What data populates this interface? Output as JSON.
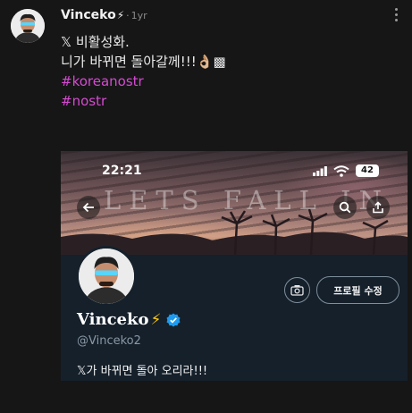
{
  "post": {
    "author": "Vinceko",
    "author_bolt": "⚡",
    "separator": "·",
    "time": "1yr",
    "more_icon": "more-dots-icon",
    "lines": [
      "𝕏 비활성화.",
      "니가 바뀌면 돌아갈께!!!👌🏼▩"
    ],
    "hashtags": [
      "#koreanostr",
      "#nostr"
    ]
  },
  "embed": {
    "status_time": "22:21",
    "battery": "42",
    "banner_text": "LETS FALL IN LOVE",
    "edit_profile": "프로필 수정",
    "display_name": "Vinceko",
    "name_bolt": "⚡",
    "handle": "@Vinceko2",
    "bio": "𝕏가 바뀌면 돌아 오리라!!!",
    "icons": [
      "back-arrow-icon",
      "search-icon",
      "share-icon",
      "camera-icon",
      "verified-badge-icon"
    ]
  },
  "colors": {
    "background": "#161616",
    "hashtag": "#d54ad2",
    "embed_background": "#15202b",
    "verified": "#1d9bf0",
    "bolt": "#f5c518"
  }
}
